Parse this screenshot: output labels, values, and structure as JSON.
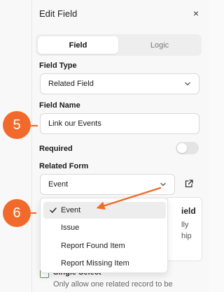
{
  "header": {
    "title": "Edit Field",
    "close_glyph": "×"
  },
  "tabs": [
    {
      "label": "Field",
      "active": true
    },
    {
      "label": "Logic",
      "active": false
    }
  ],
  "field_type": {
    "label": "Field Type",
    "value": "Related Field"
  },
  "field_name": {
    "label": "Field Name",
    "value": "Link our Events"
  },
  "required": {
    "label": "Required",
    "checked": false
  },
  "related_form": {
    "label": "Related Form",
    "value": "Event",
    "external_link_icon": "external-link-icon"
  },
  "dropdown": {
    "options": [
      {
        "label": "Event",
        "selected": true
      },
      {
        "label": "Issue",
        "selected": false
      },
      {
        "label": "Report Found Item",
        "selected": false
      },
      {
        "label": "Report Missing Item",
        "selected": false
      }
    ]
  },
  "background": {
    "card_lines": [
      "ield",
      "lly",
      "hip"
    ],
    "option_title": "Single Select",
    "option_desc": "Only allow one related record to be"
  },
  "annotations": {
    "badge_5": "5",
    "badge_6": "6",
    "accent_color": "#f26a2b"
  }
}
